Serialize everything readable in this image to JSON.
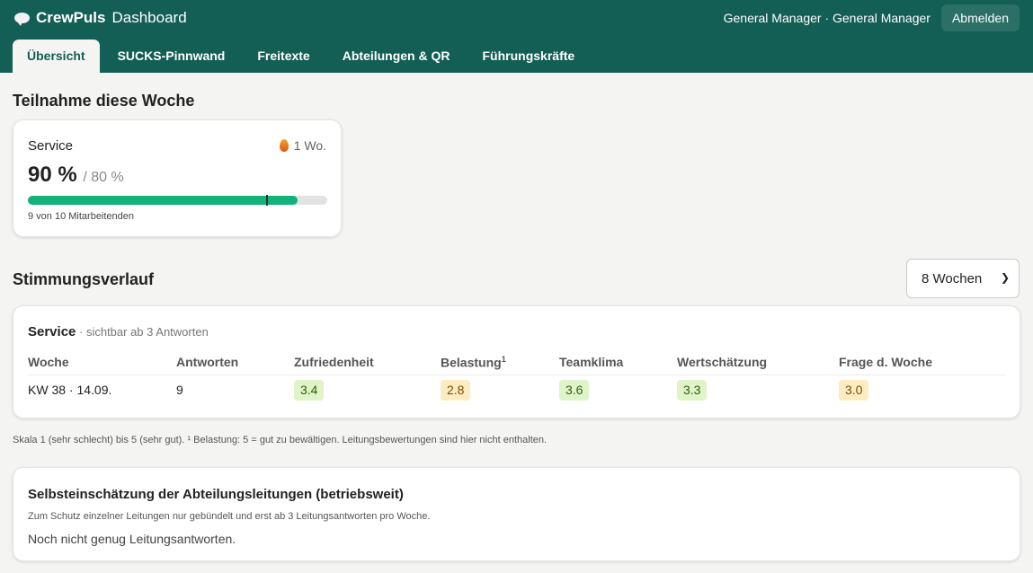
{
  "header": {
    "brand_bold": "CrewPuls",
    "brand_rest": "Dashboard",
    "user": "General Manager · General Manager",
    "logout_label": "Abmelden",
    "tabs": [
      {
        "label": "Übersicht"
      },
      {
        "label": "SUCKS-Pinnwand"
      },
      {
        "label": "Freitexte"
      },
      {
        "label": "Abteilungen & QR"
      },
      {
        "label": "Führungskräfte"
      }
    ]
  },
  "participation": {
    "heading": "Teilnahme diese Woche",
    "card": {
      "department": "Service",
      "streak": "1 Wo.",
      "percent": "90 %",
      "target": "/ 80 %",
      "fill_fraction": 0.9,
      "target_fraction": 0.8,
      "count_text": "9 von 10 Mitarbeitenden"
    }
  },
  "mood": {
    "heading": "Stimmungsverlauf",
    "range_select": "8 Wochen",
    "card": {
      "department": "Service",
      "note": " · sichtbar ab 3 Antworten",
      "columns": [
        "Woche",
        "Antworten",
        "Zufriedenheit",
        "Belastung",
        "Teamklima",
        "Wertschätzung",
        "Frage d. Woche"
      ],
      "belastung_sup": "1",
      "rows": [
        {
          "week": "KW 38 · 14.09.",
          "answers": "9",
          "zufriedenheit": "3.4",
          "belastung": "2.8",
          "teamklima": "3.6",
          "wertschaetzung": "3.3",
          "frage": "3.0"
        }
      ]
    },
    "footnote": "Skala 1 (sehr schlecht) bis 5 (sehr gut). ¹ Belastung: 5 = gut zu bewältigen. Leitungsbewertungen sind hier nicht enthalten."
  },
  "leaders": {
    "title": "Selbsteinschätzung der Abteilungsleitungen (betriebsweit)",
    "subtitle": "Zum Schutz einzelner Leitungen nur gebündelt und erst ab 3 Leitungsantworten pro Woche.",
    "empty": "Noch nicht genug Leitungsantworten."
  },
  "colors": {
    "header_bg": "#135e55",
    "progress": "#12b27a",
    "good_pill": "#dff4c8",
    "mid_pill": "#fdecc1"
  }
}
